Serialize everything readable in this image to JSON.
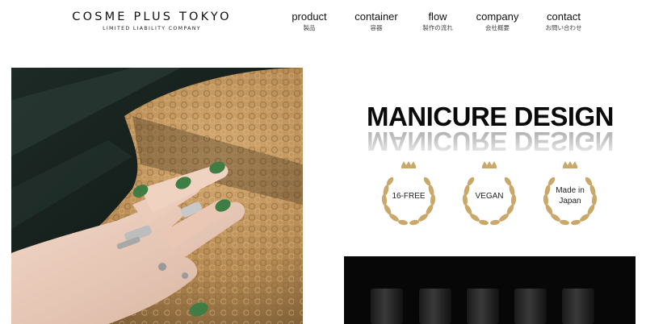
{
  "header": {
    "logo_main": "COSME PLUS TOKYO",
    "logo_sub": "LIMITED LIABILITY COMPANY",
    "nav": [
      {
        "label": "product",
        "sub": "製品"
      },
      {
        "label": "container",
        "sub": "容器"
      },
      {
        "label": "flow",
        "sub": "製作の流れ"
      },
      {
        "label": "company",
        "sub": "会社概要"
      },
      {
        "label": "contact",
        "sub": "お問い合わせ"
      }
    ]
  },
  "hero": {
    "title": "MANICURE DESIGN",
    "badges": [
      {
        "line1": "16-FREE",
        "line2": ""
      },
      {
        "line1": "VEGAN",
        "line2": ""
      },
      {
        "line1": "Made in",
        "line2": "Japan"
      }
    ]
  },
  "colors": {
    "text": "#111111",
    "gold": "#c9a86a",
    "nail_green": "#3f7d45",
    "fleece": "#b98c55"
  }
}
